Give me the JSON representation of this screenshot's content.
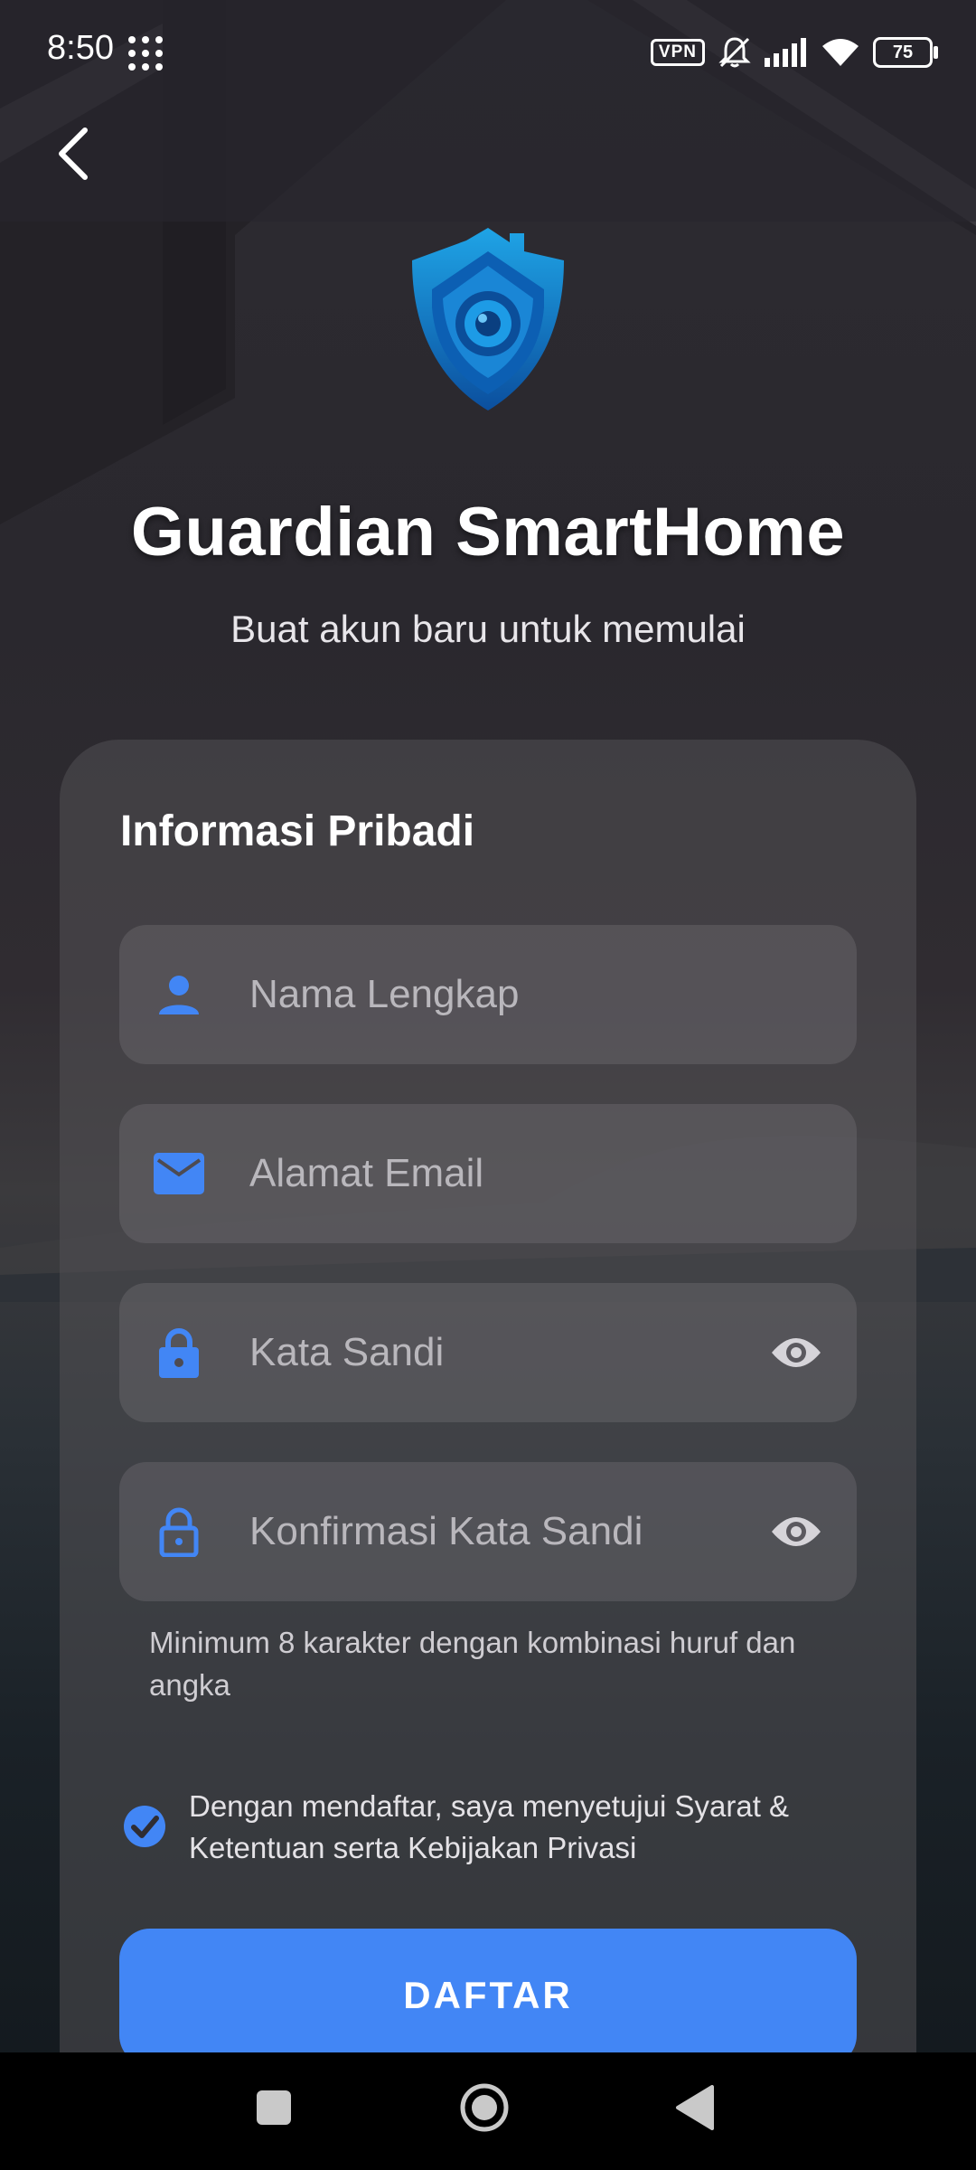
{
  "status_bar": {
    "time": "8:50",
    "vpn": "VPN",
    "battery": "75"
  },
  "header": {
    "app_title": "Guardian SmartHome",
    "subtitle": "Buat akun baru untuk memulai"
  },
  "form": {
    "section_title": "Informasi Pribadi",
    "fields": [
      {
        "placeholder": "Nama Lengkap",
        "icon": "person-icon"
      },
      {
        "placeholder": "Alamat Email",
        "icon": "email-icon"
      },
      {
        "placeholder": "Kata Sandi",
        "icon": "lock-icon"
      },
      {
        "placeholder": "Konfirmasi Kata Sandi",
        "icon": "lock-outline-icon"
      }
    ],
    "password_hint": "Minimum 8 karakter dengan kombinasi huruf dan angka",
    "terms_text": "Dengan mendaftar, saya menyetujui Syarat & Ketentuan serta Kebijakan Privasi",
    "terms_checked": true,
    "submit_label": "DAFTAR"
  },
  "colors": {
    "accent": "#4286f5",
    "card_bg": "#524f54",
    "placeholder": "#b9b7bc"
  }
}
